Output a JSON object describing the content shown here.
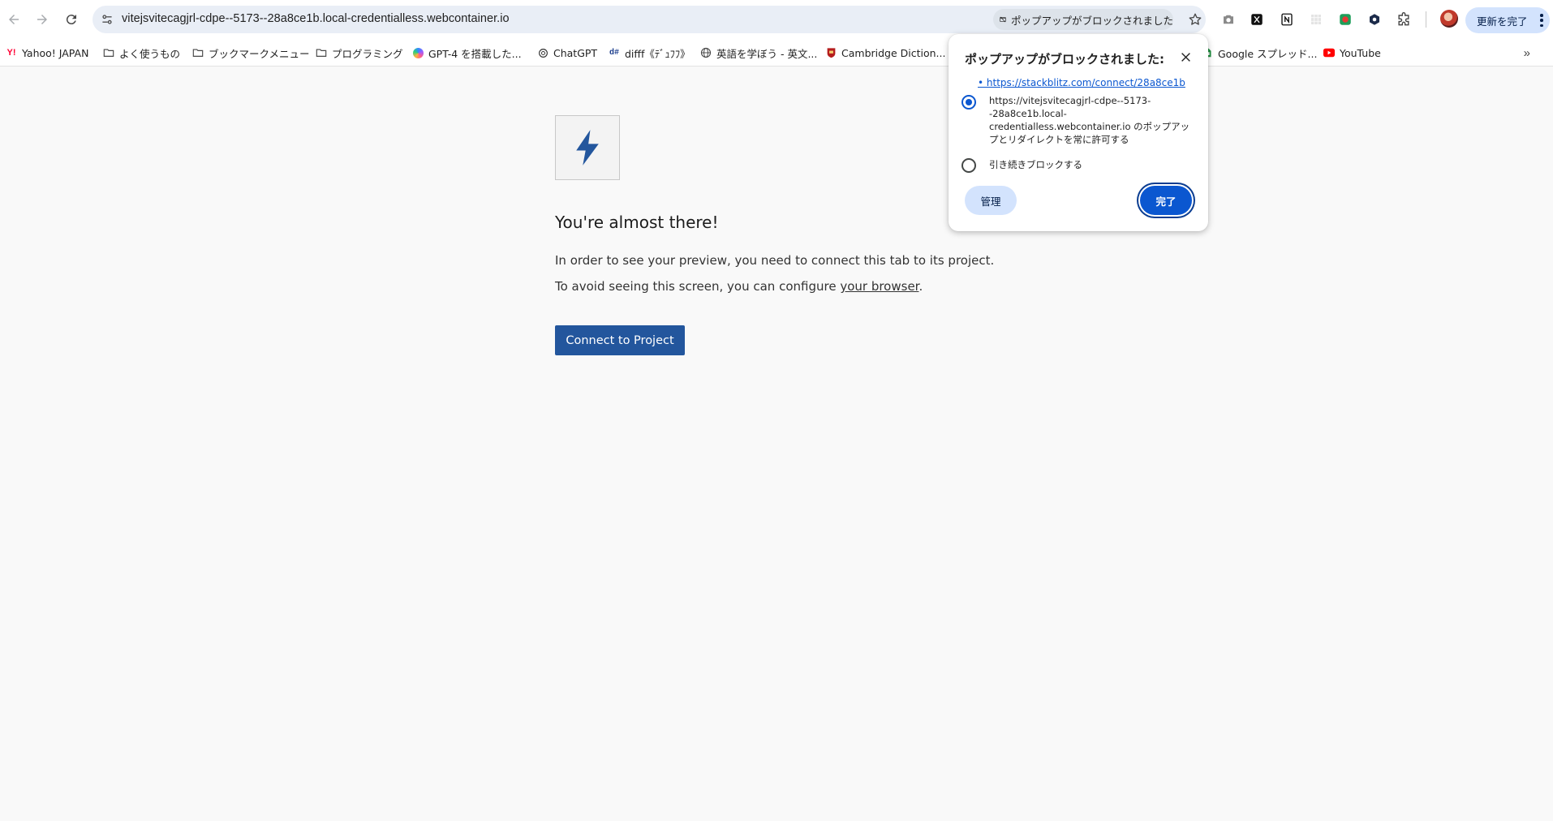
{
  "toolbar": {
    "url": "vitejsvitecagjrl-cdpe--5173--28a8ce1b.local-credentialless.webcontainer.io",
    "popup_blocked_chip": "ポップアップがブロックされました",
    "update_button": "更新を完了"
  },
  "bookmarks": [
    {
      "label": "Yahoo! JAPAN",
      "icon": "yahoo-icon"
    },
    {
      "label": "よく使うもの",
      "icon": "folder-icon"
    },
    {
      "label": "ブックマークメニュー",
      "icon": "folder-icon"
    },
    {
      "label": "プログラミング",
      "icon": "folder-icon"
    },
    {
      "label": "GPT-4 を搭載した...",
      "icon": "copilot-icon"
    },
    {
      "label": "ChatGPT",
      "icon": "chatgpt-icon"
    },
    {
      "label": "difff《ﾃﾞｭﾌﾌ》",
      "icon": "difff-icon"
    },
    {
      "label": "英語を学ぼう - 英文...",
      "icon": "globe-icon"
    },
    {
      "label": "Cambridge Diction...",
      "icon": "cambridge-icon"
    },
    {
      "label": "Google スプレッド...",
      "icon": "sheets-icon"
    },
    {
      "label": "YouTube",
      "icon": "youtube-icon"
    }
  ],
  "page": {
    "headline": "You're almost there!",
    "line1": "In order to see your preview, you need to connect this tab to its project.",
    "line2_prefix": "To avoid seeing this screen, you can configure ",
    "line2_link": "your browser",
    "line2_suffix": ".",
    "connect_button": "Connect to Project"
  },
  "dialog": {
    "title": "ポップアップがブロックされました:",
    "blocked_link": "•  https://stackblitz.com/connect/28a8ce1b",
    "option_allow": "https://vitejsvitecagjrl-cdpe--5173--28a8ce1b.local-credentialless.webcontainer.io のポップアップとリダイレクトを常に許可する",
    "option_block": "引き続きブロックする",
    "selected": "allow",
    "manage_button": "管理",
    "done_button": "完了"
  },
  "colors": {
    "accent": "#0b57d0",
    "stackblitz_blue": "#23569d",
    "omnibox": "#e9eef6"
  }
}
